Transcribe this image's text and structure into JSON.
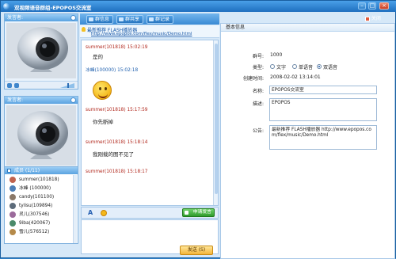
{
  "window": {
    "title": "双视频语音群组-EPOPOS交流室",
    "close_label": "关闭"
  },
  "video_panels": [
    {
      "label": "发言者:"
    },
    {
      "label": "发言者:"
    }
  ],
  "members": {
    "header": "成员 (1/11)",
    "items": [
      {
        "name": "summer(101818)"
      },
      {
        "name": "冰峰 (100000)"
      },
      {
        "name": "candy(101100)"
      },
      {
        "name": "tylisu(109894)"
      },
      {
        "name": "灵儿(307546)"
      },
      {
        "name": "9iba(420067)"
      },
      {
        "name": "雪儿(576512)"
      }
    ]
  },
  "tabs": [
    {
      "label": "群信息"
    },
    {
      "label": "群共享"
    },
    {
      "label": "群记录"
    }
  ],
  "news": {
    "title": "最新推荐 FLASH播放器",
    "url": "http://www.epopos.com/flex/music/Demo.html"
  },
  "messages": [
    {
      "sender": "summer(101818)",
      "time": "15:02:19",
      "text": "是的"
    },
    {
      "sender": "冰峰(100000)",
      "time": "15:02:18",
      "text": ""
    },
    {
      "sender": "summer(101818)",
      "time": "15:17:59",
      "text": "你先断掉"
    },
    {
      "sender": "summer(101818)",
      "time": "15:18:14",
      "text": "我刚载的图不见了"
    },
    {
      "sender": "summer(101818)",
      "time": "15:18:17",
      "text": ""
    }
  ],
  "toolbar": {
    "apply_label": "申请发言",
    "send_label": "发送 (S)"
  },
  "info": {
    "header": "基本信息",
    "group_no_label": "群号:",
    "group_no": "1000",
    "type_label": "类型:",
    "types": [
      {
        "label": "文字",
        "selected": false
      },
      {
        "label": "单语音",
        "selected": false
      },
      {
        "label": "双语音",
        "selected": true
      }
    ],
    "created_label": "创建时间:",
    "created": "2008-02-02 13:14:01",
    "name_label": "名称:",
    "name": "EPOPOS交流室",
    "desc_label": "描述:",
    "desc": "EPOPOS",
    "notice_label": "公告:",
    "notice": "最新推荐 FLASH播放器 http://www.epopos.com/flex/music/Demo.html"
  }
}
